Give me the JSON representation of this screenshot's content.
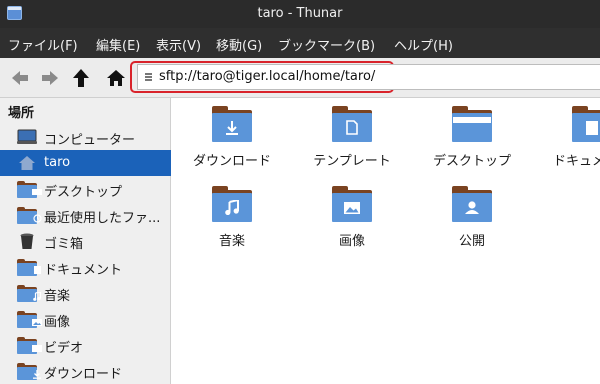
{
  "window": {
    "title": "taro - Thunar"
  },
  "menubar": {
    "items": [
      "ファイル(F)",
      "編集(E)",
      "表示(V)",
      "移動(G)",
      "ブックマーク(B)",
      "ヘルプ(H)"
    ]
  },
  "toolbar": {
    "location_path": "sftp://taro@tiger.local/home/taro/"
  },
  "sidebar": {
    "heading": "場所",
    "items": [
      {
        "label": "コンピューター",
        "icon": "computer-icon",
        "selected": false
      },
      {
        "label": "taro",
        "icon": "home-icon",
        "selected": true
      },
      {
        "label": "デスクトップ",
        "icon": "desktop-folder-icon",
        "selected": false
      },
      {
        "label": "最近使用したファ...",
        "icon": "recent-folder-icon",
        "selected": false
      },
      {
        "label": "ゴミ箱",
        "icon": "trash-icon",
        "selected": false
      },
      {
        "label": "ドキュメント",
        "icon": "documents-folder-icon",
        "selected": false
      },
      {
        "label": "音楽",
        "icon": "music-folder-icon",
        "selected": false
      },
      {
        "label": "画像",
        "icon": "pictures-folder-icon",
        "selected": false
      },
      {
        "label": "ビデオ",
        "icon": "videos-folder-icon",
        "selected": false
      },
      {
        "label": "ダウンロード",
        "icon": "downloads-folder-icon",
        "selected": false
      }
    ]
  },
  "main": {
    "files": [
      {
        "label": "ダウンロード",
        "icon": "downloads-folder-icon"
      },
      {
        "label": "テンプレート",
        "icon": "templates-folder-icon"
      },
      {
        "label": "デスクトップ",
        "icon": "desktop-folder-icon"
      },
      {
        "label": "ドキュメント",
        "icon": "documents-folder-icon"
      },
      {
        "label": "音楽",
        "icon": "music-folder-icon"
      },
      {
        "label": "画像",
        "icon": "pictures-folder-icon"
      },
      {
        "label": "公開",
        "icon": "public-folder-icon"
      }
    ]
  },
  "colors": {
    "selection": "#1b62b9",
    "folder_blue": "#5b95d9",
    "folder_tab": "#7a4321",
    "highlight_box": "#d9232b"
  }
}
